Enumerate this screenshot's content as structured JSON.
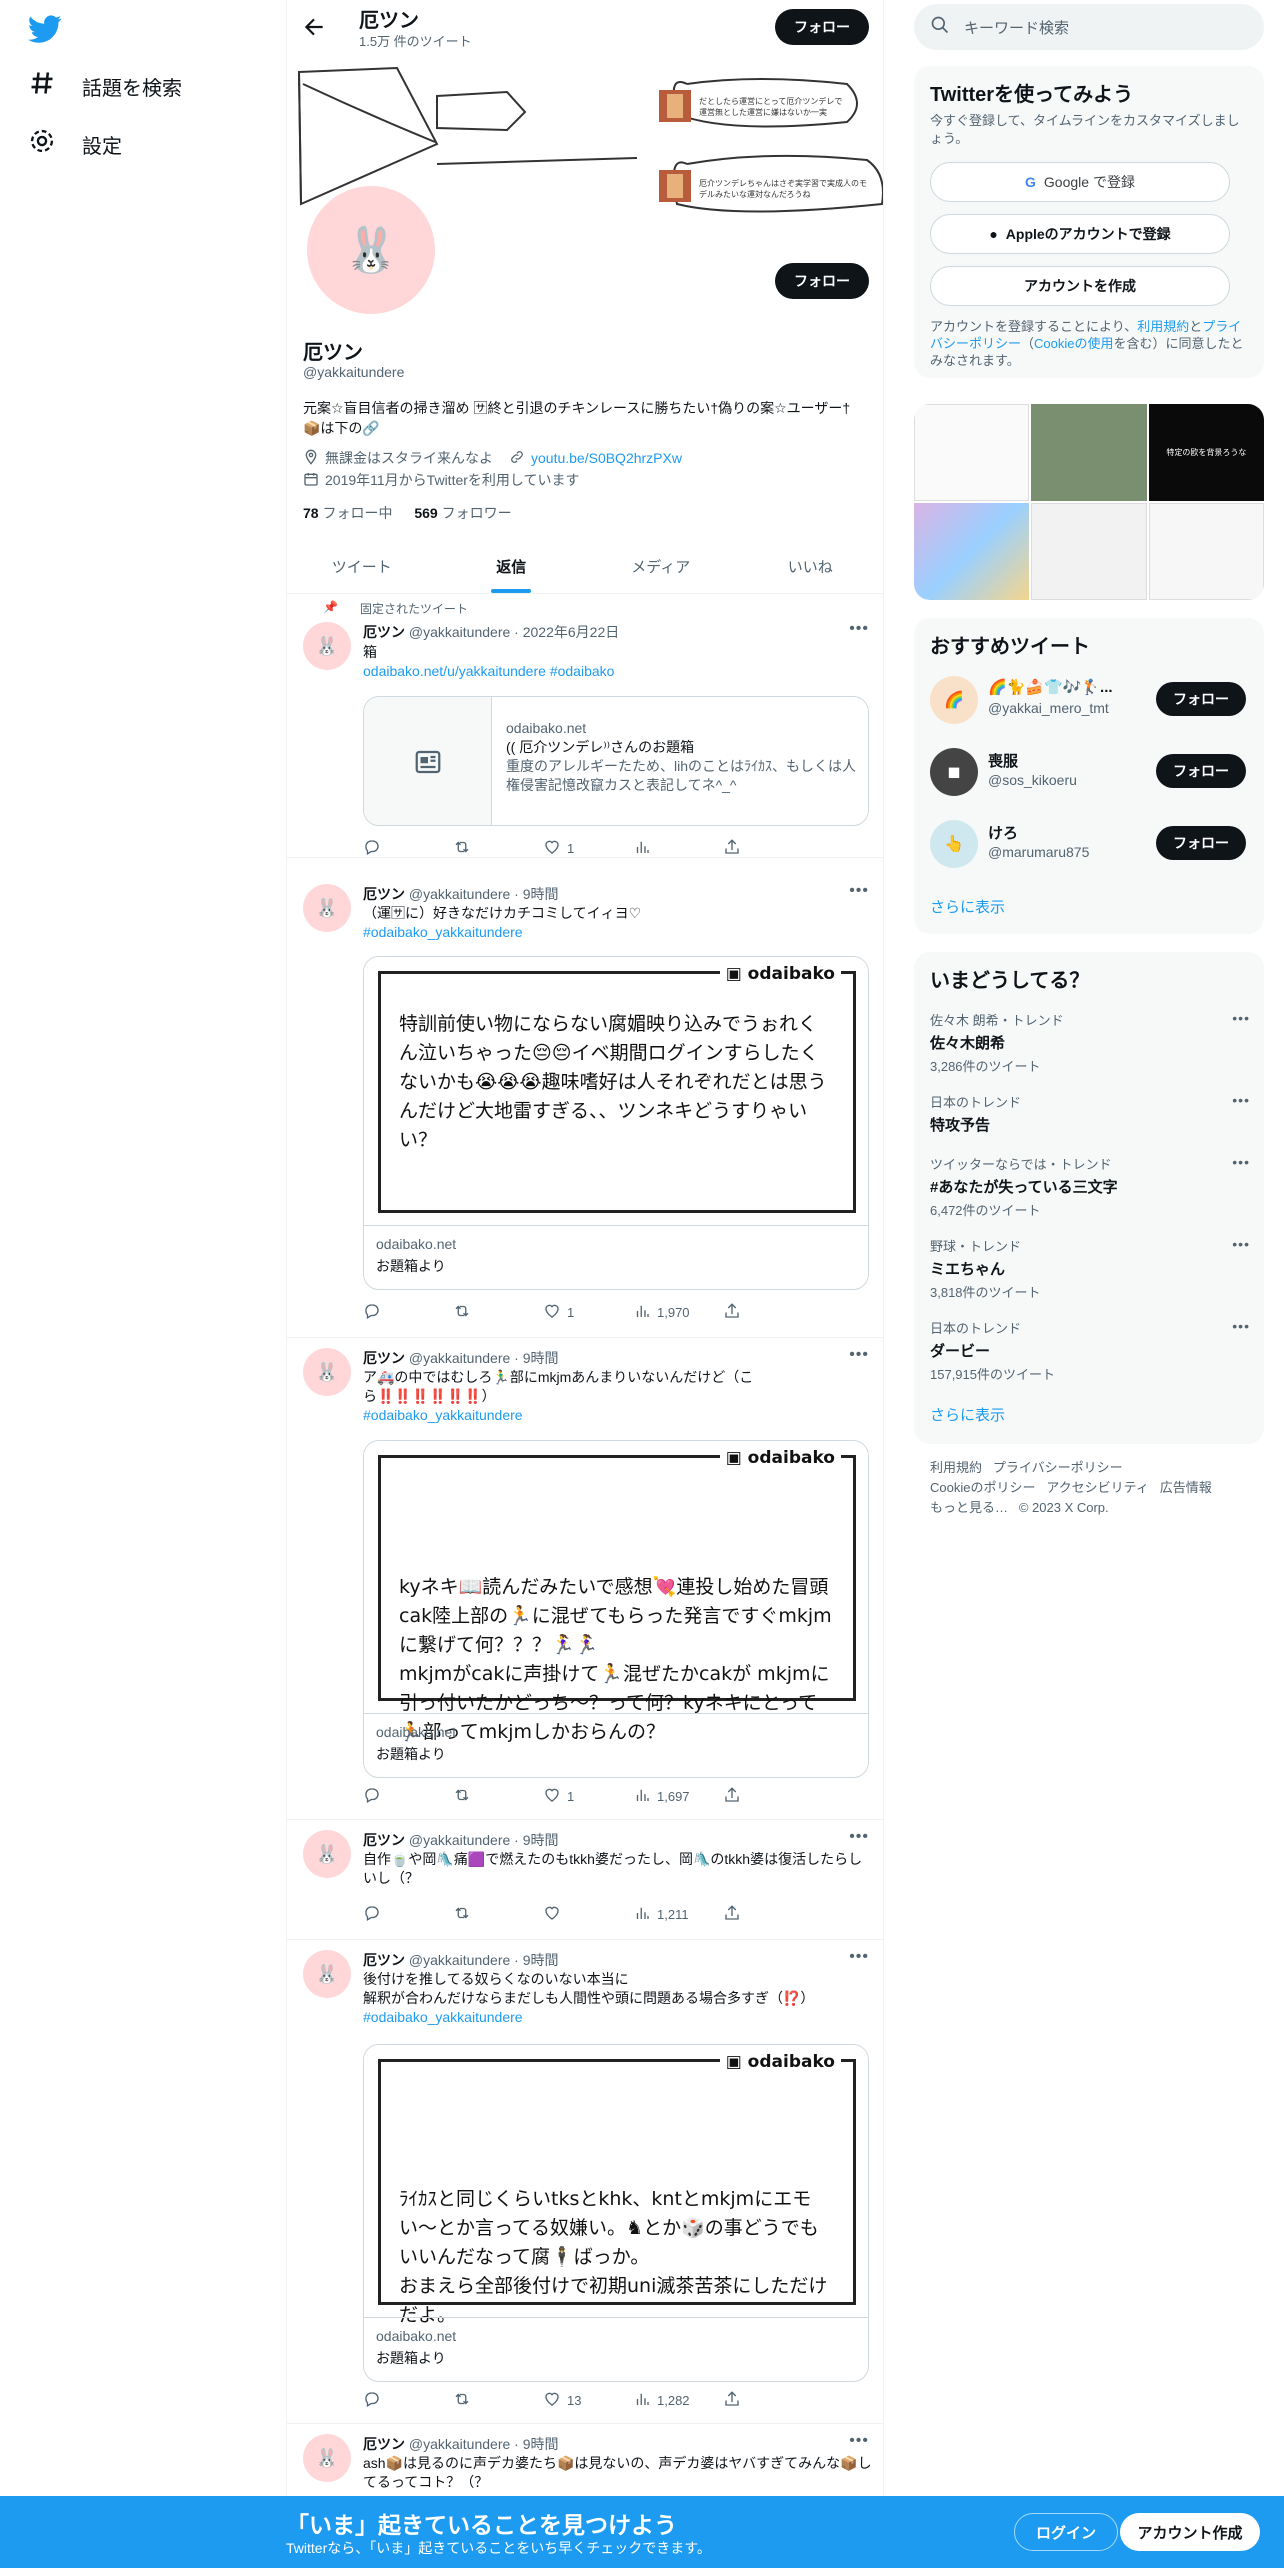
{
  "nav": {
    "explore": "話題を検索",
    "settings": "設定"
  },
  "profile": {
    "name": "厄ツン",
    "tweet_count": "1.5万 件のツイート",
    "follow_label": "フォロー",
    "handle": "@yakkaitundere",
    "bio": "元案☆盲目信者の掃き溜め 🈂終と引退のチキンレースに勝ちたい†偽りの案☆ユーザー† 📦は下の🔗",
    "location": "無課金はスタライ来んなよ",
    "link": "youtu.be/S0BQ2hrzPXw",
    "joined": "2019年11月からTwitterを利用しています",
    "following_count": "78",
    "following_label": "フォロー中",
    "followers_count": "569",
    "followers_label": "フォロワー",
    "banner_note1": "だとしたら運営にとって厄介ツンデレで運営無とした運営に嫌はないか一実",
    "banner_note2": "厄介ツンデレちゃんはさぞ実学習で実成人のモデルみたいな運対なんだろうね"
  },
  "tabs": [
    "ツイート",
    "返信",
    "メディア",
    "いいね"
  ],
  "active_tab": "返信",
  "tweets": [
    {
      "pinned_label": "固定されたツイート",
      "name": "厄ツン",
      "handle": "@yakkaitundere",
      "time": "2022年6月22日",
      "text1": "箱",
      "link": "odaibako.net/u/yakkaitundere",
      "tag": "#odaibako",
      "card_domain": "odaibako.net",
      "card_title": "(( 厄介ツンデレ⁾⁾さんのお題箱",
      "card_desc": "重度のアレルギーたため、lihのことはﾗｲｶｽ、もしくは人権侵害記憶改竄カスと表記してネ^_^",
      "replies": "",
      "retweets": "",
      "likes": "1",
      "views": ""
    },
    {
      "name": "厄ツン",
      "handle": "@yakkaitundere",
      "time": "9時間",
      "text1": "（運🈂に）好きなだけカチコミしてイィヨ♡",
      "tag": "#odaibako_yakkaitundere",
      "image_logo": "odaibako",
      "image_text": "特訓前使い物にならない腐媚映り込みでうぉれくん泣いちゃった😔😔イベ期間ログインすらしたくないかも😭😭😭趣味嗜好は人それぞれだとは思うんだけど大地雷すぎる、、ツンネキどうすりゃいい？",
      "card_domain": "odaibako.net",
      "card_title": "お題箱より",
      "replies": "",
      "retweets": "",
      "likes": "1",
      "views": "1,970"
    },
    {
      "name": "厄ツン",
      "handle": "@yakkaitundere",
      "time": "9時間",
      "text1": "ア🚑の中ではむしろ🏃‍♂️部にmkjmあんまりいないんだけど（こら‼️‼️‼️‼️‼️‼️）",
      "tag": "#odaibako_yakkaitundere",
      "image_logo": "odaibako",
      "image_text": "kyネキ📖読んだみたいで感想💘連投し始めた冒頭cak陸上部の🏃に混ぜてもらった発言ですぐmkjmに繋げて何？？？🏃‍♀️🏃‍♀️\nmkjmがcakに声掛けて🏃混ぜたかcakが mkjmに引っ付いたかどっち〜？って何？kyネキにとって🏃部ってmkjmしかおらんの？",
      "card_domain": "odaibako.net",
      "card_title": "お題箱より",
      "replies": "",
      "retweets": "",
      "likes": "1",
      "views": "1,697"
    },
    {
      "name": "厄ツン",
      "handle": "@yakkaitundere",
      "time": "9時間",
      "text1": "自作🍵や岡🛝痛🟪で燃えたのもtkkh婆だったし、岡🛝のtkkh婆は復活したらしいし（？",
      "replies": "",
      "retweets": "",
      "likes": "",
      "views": "1,211"
    },
    {
      "name": "厄ツン",
      "handle": "@yakkaitundere",
      "time": "9時間",
      "text1": "後付けを推してる奴らくなのいない本当に",
      "text2": "解釈が合わんだけならまだしも人間性や頭に問題ある場合多すぎ（⁉️）",
      "tag": "#odaibako_yakkaitundere",
      "image_logo": "odaibako",
      "image_text": "ﾗｲｶｽと同じくらいtksとkhk、kntとmkjmにエモい〜とか言ってる奴嫌い。♞とか🎲の事どうでもいいんだなって腐🕴ばっか。\nおまえら全部後付けで初期uni滅茶苦茶にしただけだよ。",
      "card_domain": "odaibako.net",
      "card_title": "お題箱より",
      "replies": "",
      "retweets": "",
      "likes": "13",
      "views": "1,282"
    },
    {
      "name": "厄ツン",
      "handle": "@yakkaitundere",
      "time": "9時間",
      "text1": "ash📦は見るのに声デカ婆たち📦は見ないの、声デカ婆はヤバすぎてみんな📦してるってコト？（？"
    }
  ],
  "right": {
    "search_placeholder": "キーワード検索",
    "signup_title": "Twitterを使ってみよう",
    "signup_sub": "今すぐ登録して、タイムラインをカスタマイズしましょう。",
    "google_btn": "Google で登録",
    "apple_btn": "Appleのアカウントで登録",
    "create_btn": "アカウントを作成",
    "terms_1": "アカウントを登録することにより、",
    "terms_link1": "利用規約",
    "terms_2": "と",
    "terms_link2": "プライバシーポリシー",
    "terms_3": "（",
    "terms_link3": "Cookieの使用",
    "terms_4": "を含む）に同意したとみなされます。",
    "media_text": "特定の欧を背景ろうな",
    "recommend_title": "おすすめツイート",
    "recommend": [
      {
        "name": "🌈🐈🍰👕🎶🏌️...",
        "handle": "@yakkai_mero_tmt",
        "follow": "フォロー"
      },
      {
        "name": "喪服",
        "handle": "@sos_kikoeru",
        "follow": "フォロー"
      },
      {
        "name": "けろ",
        "handle": "@marumaru875",
        "follow": "フォロー"
      }
    ],
    "show_more": "さらに表示",
    "trends_title": "いまどうしてる？",
    "trends": [
      {
        "context": "佐々木 朗希・トレンド",
        "name": "佐々木朗希",
        "count": "3,286件のツイート"
      },
      {
        "context": "日本のトレンド",
        "name": "特攻予告",
        "count": ""
      },
      {
        "context": "ツイッターならでは・トレンド",
        "name": "#あなたが失っている三文字",
        "count": "6,472件のツイート"
      },
      {
        "context": "野球・トレンド",
        "name": "ミエちゃん",
        "count": "3,818件のツイート"
      },
      {
        "context": "日本のトレンド",
        "name": "ダービー",
        "count": "157,915件のツイート"
      }
    ],
    "trends_more": "さらに表示",
    "footer": [
      "利用規約",
      "プライバシーポリシー",
      "Cookieのポリシー",
      "アクセシビリティ",
      "広告情報",
      "もっと見る…",
      "© 2023 X Corp."
    ]
  },
  "bottom": {
    "title": "「いま」起きていることを見つけよう",
    "sub": "Twitterなら、「いま」起きていることをいち早くチェックできます。",
    "login": "ログイン",
    "signup": "アカウント作成"
  },
  "colors": {
    "accent": "#1d9bf0",
    "text": "#0f1419",
    "muted": "#536471",
    "avatar_bg": "#ffd7d9"
  }
}
